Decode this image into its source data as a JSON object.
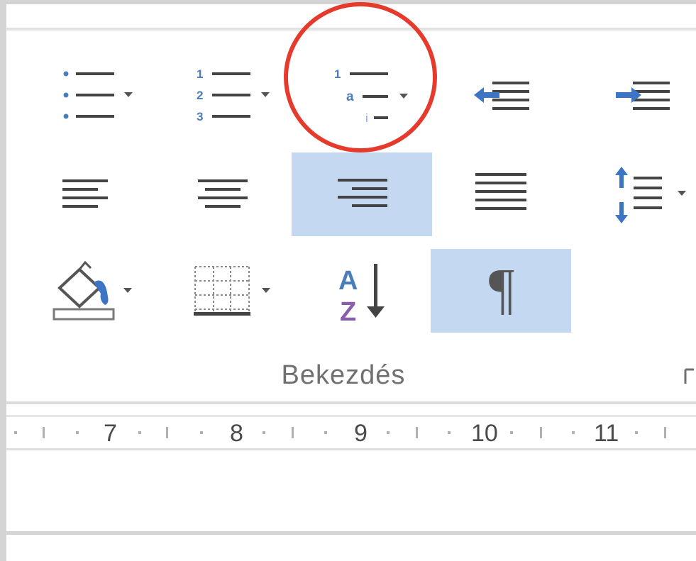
{
  "ribbon": {
    "group_label": "Bekezdés",
    "buttons": [
      {
        "id": "bullets",
        "icon": "bullet-list-icon",
        "has_dropdown": true,
        "active": false
      },
      {
        "id": "numbering",
        "icon": "numbered-list-icon",
        "has_dropdown": true,
        "active": false
      },
      {
        "id": "multilevel-list",
        "icon": "multilevel-list-icon",
        "has_dropdown": true,
        "active": false,
        "highlighted": true
      },
      {
        "id": "decrease-indent",
        "icon": "decrease-indent-icon",
        "has_dropdown": false,
        "active": false
      },
      {
        "id": "increase-indent",
        "icon": "increase-indent-icon",
        "has_dropdown": false,
        "active": false
      },
      {
        "id": "align-left",
        "icon": "align-left-icon",
        "has_dropdown": false,
        "active": false
      },
      {
        "id": "align-center",
        "icon": "align-center-icon",
        "has_dropdown": false,
        "active": false
      },
      {
        "id": "align-right",
        "icon": "align-right-icon",
        "has_dropdown": false,
        "active": true
      },
      {
        "id": "justify",
        "icon": "justify-icon",
        "has_dropdown": false,
        "active": false
      },
      {
        "id": "line-spacing",
        "icon": "line-spacing-icon",
        "has_dropdown": true,
        "active": false
      },
      {
        "id": "shading",
        "icon": "paint-bucket-icon",
        "has_dropdown": true,
        "active": false
      },
      {
        "id": "borders",
        "icon": "borders-icon",
        "has_dropdown": true,
        "active": false
      },
      {
        "id": "sort",
        "icon": "sort-az-icon",
        "has_dropdown": false,
        "active": false
      },
      {
        "id": "show-hide",
        "icon": "pilcrow-icon",
        "has_dropdown": false,
        "active": true
      }
    ],
    "icon_glyphs": {
      "numbers": [
        "1",
        "2",
        "3"
      ],
      "multilevel": [
        "1",
        "a",
        "i"
      ],
      "sort_letters": [
        "A",
        "Z"
      ],
      "pilcrow": "¶"
    }
  },
  "ruler": {
    "numbers": [
      "7",
      "8",
      "9",
      "10",
      "11"
    ]
  },
  "colors": {
    "accent_blue": "#4a7ebb",
    "active_bg": "#c5d8f2",
    "highlight_circle": "#e53a2c",
    "sort_z": "#8b5fa8"
  }
}
